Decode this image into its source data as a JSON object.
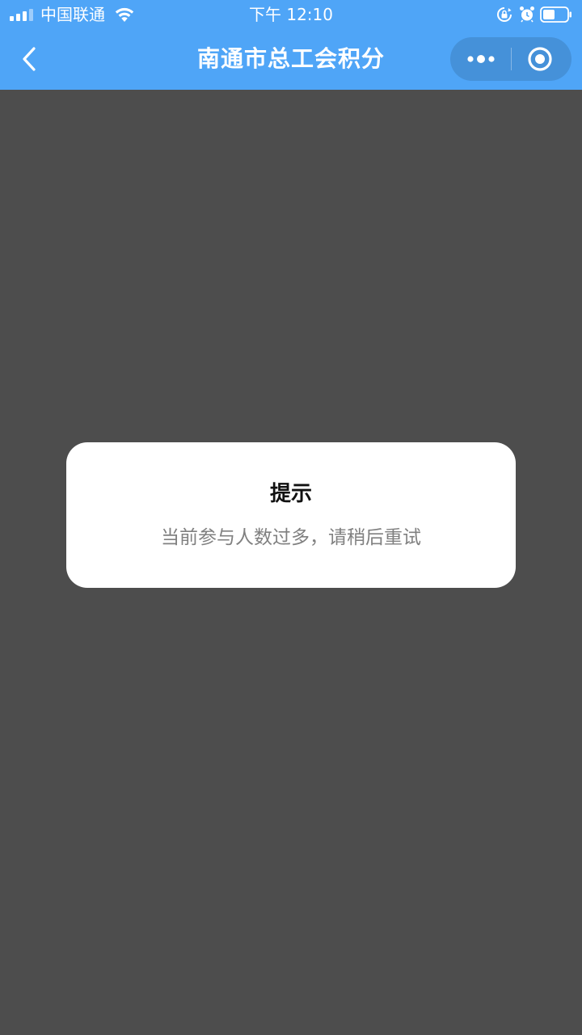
{
  "status_bar": {
    "carrier": "中国联通",
    "time": "下午 12:10",
    "battery_level": 0.5
  },
  "nav": {
    "title": "南通市总工会积分",
    "icons": [
      "back-chevron-icon",
      "more-dots-icon",
      "close-miniprogram-icon"
    ]
  },
  "dialog": {
    "title": "提示",
    "message": "当前参与人数过多，请稍后重试"
  },
  "colors": {
    "header_bg": "#4fa5f7",
    "overlay_bg": "#4d4d4d",
    "dialog_bg": "#ffffff",
    "message_text": "#808080"
  }
}
